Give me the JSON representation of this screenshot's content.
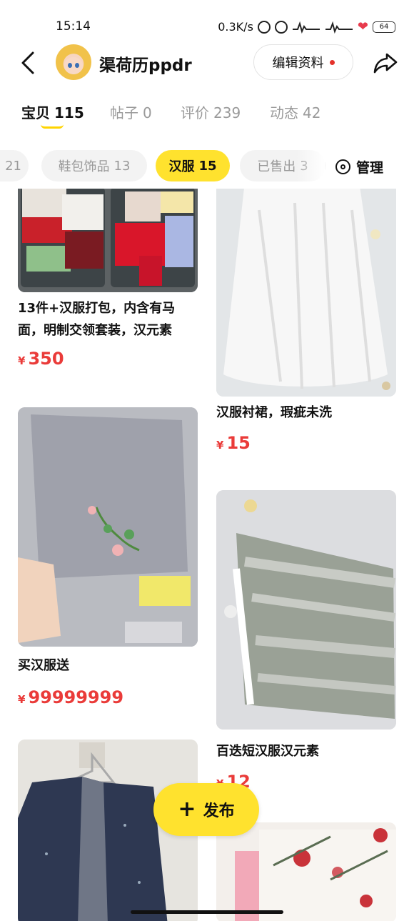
{
  "status_bar": {
    "time": "15:14",
    "network_speed": "0.3K/s",
    "battery": "64"
  },
  "header": {
    "username": "渠荷历ppdr",
    "edit_label": "编辑资料"
  },
  "main_tabs": [
    {
      "label": "宝贝",
      "count": "115",
      "active": true
    },
    {
      "label": "帖子",
      "count": "0",
      "active": false
    },
    {
      "label": "评价",
      "count": "239",
      "active": false
    },
    {
      "label": "动态",
      "count": "42",
      "active": false
    }
  ],
  "category_chips": [
    {
      "label": "",
      "count": "21"
    },
    {
      "label": "鞋包饰品",
      "count": "13"
    },
    {
      "label": "汉服",
      "count": "15"
    },
    {
      "label": "已售出",
      "count": "3"
    }
  ],
  "manage_label": "管理",
  "items": [
    {
      "title": "13件+汉服打包，内含有马面，明制交领套装，汉元素",
      "currency": "¥",
      "price": "350"
    },
    {
      "title": "汉服衬裙，瑕疵未洗",
      "currency": "¥",
      "price": "15"
    },
    {
      "title": "买汉服送",
      "currency": "¥",
      "price": "99999999"
    },
    {
      "title": "百迭短汉服汉元素",
      "currency": "¥",
      "price": "12"
    }
  ],
  "fab_label": "发布",
  "colors": {
    "accent": "#ffe22e",
    "price": "#ea3b39",
    "inactive_text": "#9a9a9a"
  }
}
